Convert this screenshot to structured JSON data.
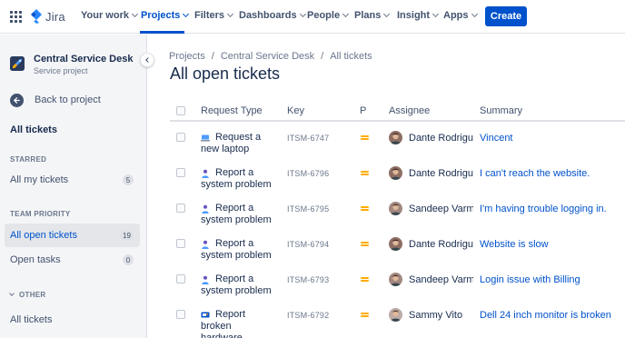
{
  "topnav": {
    "logo_text": "Jira",
    "items": [
      {
        "label": "Your work"
      },
      {
        "label": "Projects"
      },
      {
        "label": "Filters"
      },
      {
        "label": "Dashboards"
      },
      {
        "label": "People"
      },
      {
        "label": "Plans"
      },
      {
        "label": "Insight"
      },
      {
        "label": "Apps"
      }
    ],
    "active_item": "Projects",
    "create_label": "Create"
  },
  "sidebar": {
    "project_name": "Central Service Desk",
    "project_type": "Service project",
    "back_label": "Back to project",
    "all_tickets_label": "All tickets",
    "starred_heading": "STARRED",
    "starred_items": [
      {
        "label": "All my tickets",
        "count": "5"
      }
    ],
    "team_priority_heading": "TEAM PRIORITY",
    "team_priority_items": [
      {
        "label": "All open tickets",
        "count": "19"
      },
      {
        "label": "Open tasks",
        "count": "0"
      }
    ],
    "other_heading": "OTHER",
    "other_items": [
      {
        "label": "All tickets"
      }
    ]
  },
  "breadcrumb": [
    "Projects",
    "Central Service Desk",
    "All tickets"
  ],
  "page_title": "All open tickets",
  "table": {
    "headers": {
      "request_type": "Request Type",
      "key": "Key",
      "priority": "P",
      "assignee": "Assignee",
      "summary": "Summary"
    },
    "rows": [
      {
        "request_type": "Request a new laptop",
        "request_icon": "laptop-icon",
        "key": "ITSM-6747",
        "priority": "medium",
        "assignee": "Dante Rodriguez",
        "summary": "Vincent"
      },
      {
        "request_type": "Report a system problem",
        "request_icon": "person-icon",
        "key": "ITSM-6796",
        "priority": "medium",
        "assignee": "Dante Rodriguez",
        "summary": "I can't reach the website."
      },
      {
        "request_type": "Report a system problem",
        "request_icon": "person-icon",
        "key": "ITSM-6795",
        "priority": "medium",
        "assignee": "Sandeep Varma",
        "summary": "I'm having trouble logging in."
      },
      {
        "request_type": "Report a system problem",
        "request_icon": "person-icon",
        "key": "ITSM-6794",
        "priority": "medium",
        "assignee": "Dante Rodriguez",
        "summary": "Website is slow"
      },
      {
        "request_type": "Report a system problem",
        "request_icon": "person-icon",
        "key": "ITSM-6793",
        "priority": "medium",
        "assignee": "Sandeep Varma",
        "summary": "Login issue with Billing"
      },
      {
        "request_type": "Report broken hardware",
        "request_icon": "hardware-icon",
        "key": "ITSM-6792",
        "priority": "medium",
        "assignee": "Sammy Vito",
        "summary": "Dell 24 inch monitor is broken"
      }
    ]
  },
  "colors": {
    "brand": "#0052cc",
    "priority_medium": "#ffab00",
    "sidebar_bg": "#f4f5f7"
  }
}
